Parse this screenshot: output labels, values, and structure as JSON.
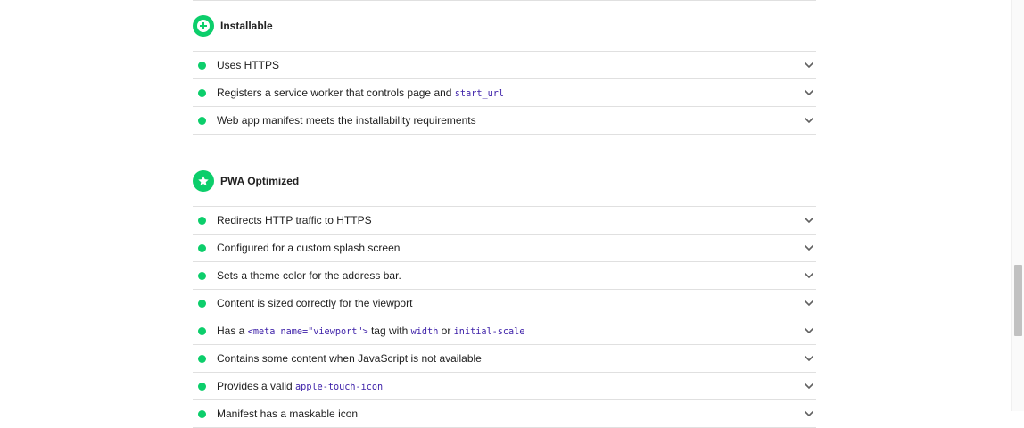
{
  "groups": [
    {
      "title": "Installable",
      "icon": "plus-circle-icon",
      "items": [
        {
          "label_parts": [
            {
              "text": "Uses HTTPS"
            }
          ]
        },
        {
          "label_parts": [
            {
              "text": "Registers a service worker that controls page and "
            },
            {
              "text": "start_url",
              "code": true
            }
          ]
        },
        {
          "label_parts": [
            {
              "text": "Web app manifest meets the installability requirements"
            }
          ]
        }
      ]
    },
    {
      "title": "PWA Optimized",
      "icon": "star-icon",
      "items": [
        {
          "label_parts": [
            {
              "text": "Redirects HTTP traffic to HTTPS"
            }
          ]
        },
        {
          "label_parts": [
            {
              "text": "Configured for a custom splash screen"
            }
          ]
        },
        {
          "label_parts": [
            {
              "text": "Sets a theme color for the address bar."
            }
          ]
        },
        {
          "label_parts": [
            {
              "text": "Content is sized correctly for the viewport"
            }
          ]
        },
        {
          "label_parts": [
            {
              "text": "Has a "
            },
            {
              "text": "<meta name=\"viewport\">",
              "code": true
            },
            {
              "text": " tag with "
            },
            {
              "text": "width",
              "code": true
            },
            {
              "text": " or "
            },
            {
              "text": "initial-scale",
              "code": true
            }
          ]
        },
        {
          "label_parts": [
            {
              "text": "Contains some content when JavaScript is not available"
            }
          ]
        },
        {
          "label_parts": [
            {
              "text": "Provides a valid "
            },
            {
              "text": "apple-touch-icon",
              "code": true
            }
          ]
        },
        {
          "label_parts": [
            {
              "text": "Manifest has a maskable icon"
            }
          ]
        }
      ]
    }
  ],
  "colors": {
    "pass": "#0cce6b",
    "code": "#3c1fa8"
  }
}
